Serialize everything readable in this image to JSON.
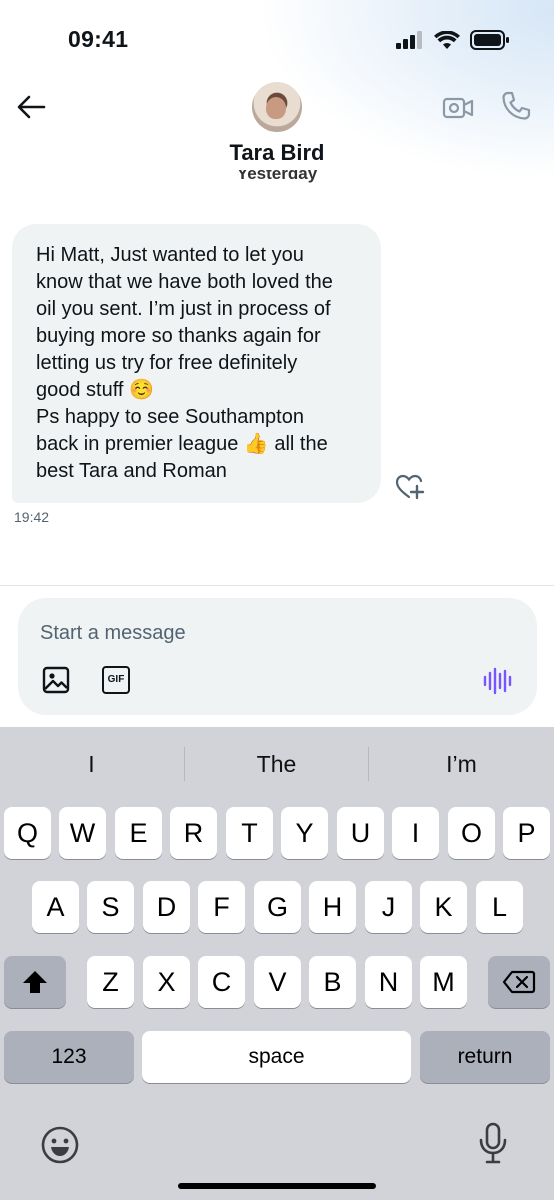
{
  "status_bar": {
    "time": "09:41"
  },
  "header": {
    "contact_name": "Tara Bird",
    "day_label": "Yesterday"
  },
  "conversation": {
    "messages": [
      {
        "text": "Hi Matt, Just wanted to let you\nknow that we have both loved the\noil you sent. I’m just in process of\nbuying more so thanks again for\nletting us try for free definitely\ngood stuff ☺️\nPs happy to see Southampton\nback in premier league 👍 all the\nbest Tara and Roman",
        "time": "19:42"
      }
    ]
  },
  "composer": {
    "placeholder": "Start a message",
    "gif_label": "GIF"
  },
  "keyboard": {
    "suggestions": [
      "I",
      "The",
      "I’m"
    ],
    "row1": [
      "Q",
      "W",
      "E",
      "R",
      "T",
      "Y",
      "U",
      "I",
      "O",
      "P"
    ],
    "row2": [
      "A",
      "S",
      "D",
      "F",
      "G",
      "H",
      "J",
      "K",
      "L"
    ],
    "row3": [
      "Z",
      "X",
      "C",
      "V",
      "B",
      "N",
      "M"
    ],
    "numbers_label": "123",
    "space_label": "space",
    "return_label": "return"
  },
  "icons": {
    "back": "arrow-left-icon",
    "video": "video-camera-icon",
    "call": "phone-icon",
    "react": "heart-plus-icon",
    "image": "image-icon",
    "gif": "gif-icon",
    "voice": "voice-wave-icon",
    "shift": "shift-arrow-icon",
    "delete": "backspace-icon",
    "emoji": "emoji-face-icon",
    "dictation": "microphone-icon"
  },
  "colors": {
    "bubble": "#eff3f4",
    "accent_voice": "#7856ff",
    "keyboard_bg": "#d1d3d9",
    "special_key": "#abb0ba"
  }
}
